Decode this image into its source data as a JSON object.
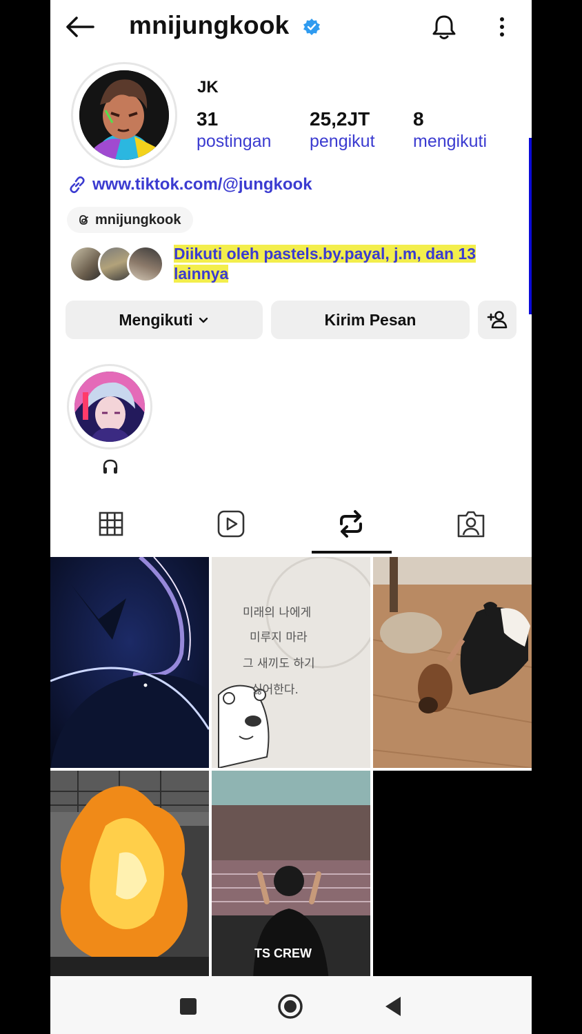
{
  "header": {
    "username": "mnijungkook",
    "back_icon": "arrow-left-icon",
    "verified_icon": "verified-badge-icon",
    "bell_icon": "bell-icon",
    "more_icon": "more-vertical-icon"
  },
  "profile": {
    "display_name": "JK",
    "stats": [
      {
        "value": "31",
        "label": "postingan"
      },
      {
        "value": "25,2JT",
        "label": "pengikut"
      },
      {
        "value": "8",
        "label": "mengikuti"
      }
    ],
    "link": "www.tiktok.com/@jungkook",
    "threads_handle": "mnijungkook",
    "followed_by": "Diikuti oleh pastels.by.payal, j.m, dan 13 lainnya"
  },
  "actions": {
    "following_label": "Mengikuti",
    "message_label": "Kirim Pesan",
    "add_user_icon": "add-user-icon"
  },
  "highlight": {
    "label_icon": "headphones-icon"
  },
  "tabs": [
    "grid-icon",
    "reels-icon",
    "reposts-icon",
    "tagged-icon"
  ],
  "grid": {
    "post2_text": [
      "미래의 나에게",
      "미루지 마라",
      "그 새끼도 하기",
      "싫어한다."
    ],
    "post5_text": "TS CREW"
  },
  "colors": {
    "accent": "#3b3bd0",
    "verified": "#2f9bf0",
    "highlight_marker": "#f3ee4c"
  }
}
